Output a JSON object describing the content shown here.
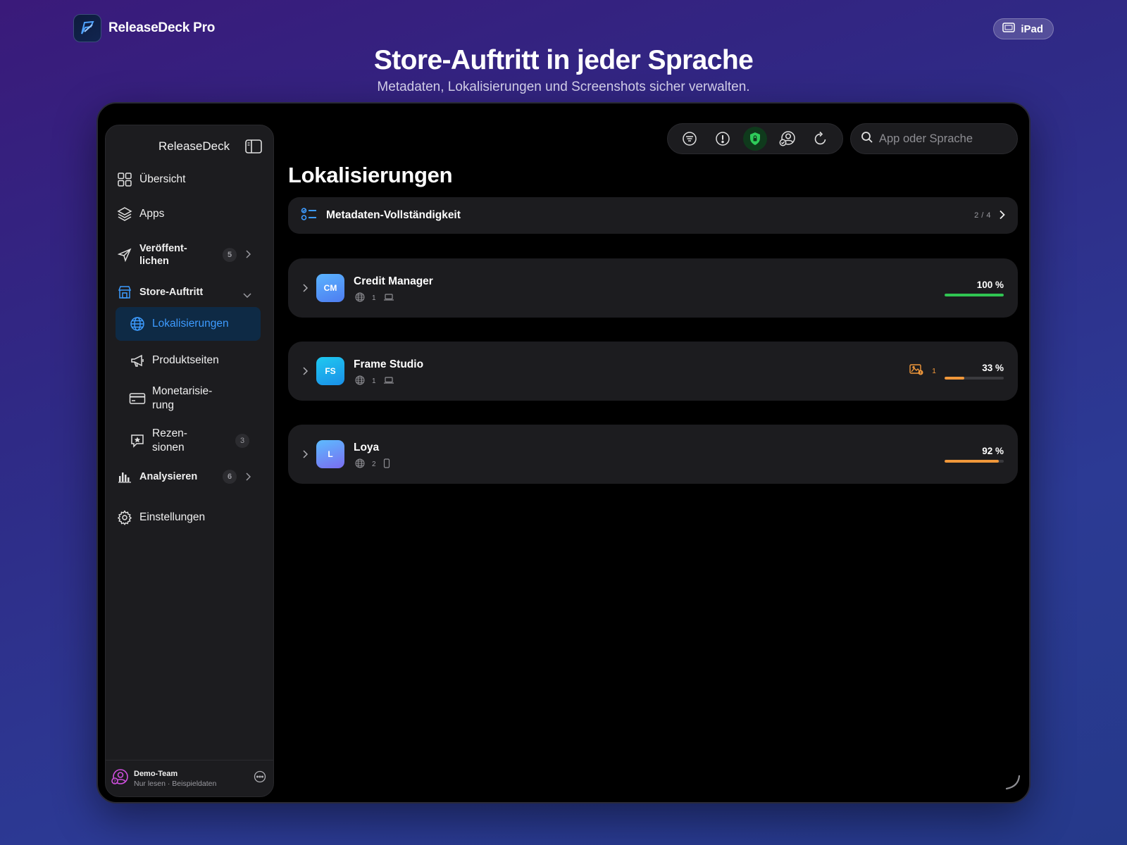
{
  "header": {
    "brand_name": "ReleaseDeck Pro",
    "device_label": "iPad",
    "hero_title": "Store-Auftritt in jeder Sprache",
    "hero_subtitle": "Metadaten, Lokalisierungen und Screenshots sicher verwalten."
  },
  "sidebar": {
    "title": "ReleaseDeck",
    "items": [
      {
        "label": "Übersicht",
        "icon": "grid-icon"
      },
      {
        "label": "Apps",
        "icon": "layers-icon"
      },
      {
        "label": "Veröffent-\nlichen",
        "badge": "5",
        "icon": "paper-plane-icon"
      },
      {
        "label": "Store-Auftritt",
        "icon": "storefront-icon"
      },
      {
        "label": "Lokalisierungen",
        "icon": "globe-icon",
        "active": true
      },
      {
        "label": "Produktseiten",
        "icon": "megaphone-icon"
      },
      {
        "label": "Monetarisie-\nrung",
        "icon": "credit-card-icon"
      },
      {
        "label": "Rezen-\nsionen",
        "badge": "3",
        "icon": "star-bubble-icon"
      },
      {
        "label": "Analysieren",
        "badge": "6",
        "icon": "bar-chart-icon"
      },
      {
        "label": "Einstellungen",
        "icon": "gear-icon"
      }
    ],
    "footer": {
      "team": "Demo-Team",
      "status": "Nur lesen · Beispieldaten"
    }
  },
  "search": {
    "placeholder": "App oder Sprache"
  },
  "main": {
    "title": "Lokalisierungen",
    "completeness": {
      "label": "Metadaten-Vollständigkeit",
      "count": "2 / 4"
    },
    "apps": [
      {
        "initials": "CM",
        "name": "Credit Manager",
        "languages": "1",
        "percent_label": "100 %",
        "progress": 1.0,
        "color": "#30c552",
        "tile_from": "#5ab4ff",
        "tile_to": "#4e7cf0",
        "device": "mac"
      },
      {
        "initials": "FS",
        "name": "Frame Studio",
        "languages": "1",
        "percent_label": "33 %",
        "progress": 0.33,
        "color": "#f0973a",
        "tile_from": "#1fc9f0",
        "tile_to": "#1a8fe8",
        "device": "mac",
        "warnings": "1"
      },
      {
        "initials": "L",
        "name": "Loya",
        "languages": "2",
        "percent_label": "92 %",
        "progress": 0.92,
        "color": "#f0973a",
        "tile_from": "#5cbcff",
        "tile_to": "#7a6cf0",
        "device": "phone"
      }
    ]
  },
  "colors": {
    "accent": "#3d9bff",
    "success": "#30c552",
    "warning": "#f0973a"
  }
}
